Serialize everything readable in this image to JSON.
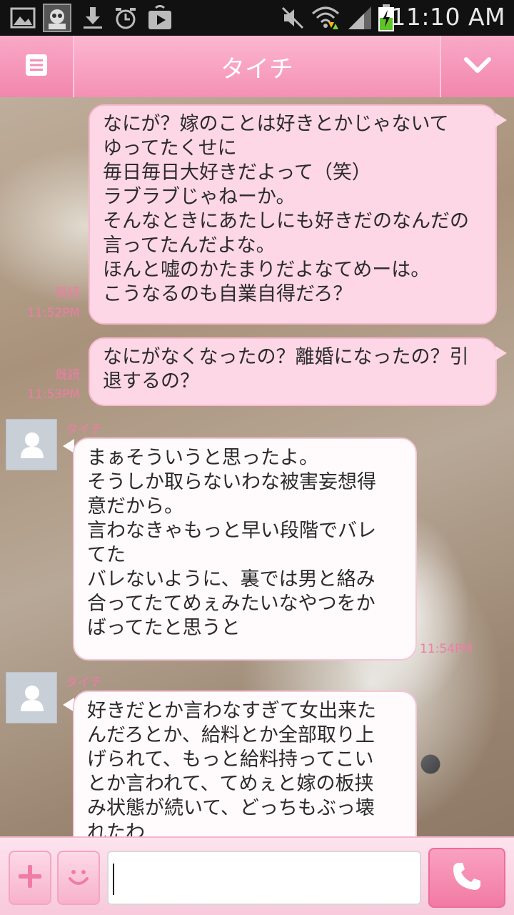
{
  "status_bar": {
    "time": "11:10 AM",
    "icons": [
      "gallery-icon",
      "app-avatar-icon",
      "download-icon",
      "alarm-icon",
      "play-store-icon",
      "mute-icon",
      "wifi-icon",
      "signal-icon",
      "battery-charging-icon"
    ]
  },
  "header": {
    "title": "タイチ",
    "menu_icon": "menu-list-icon",
    "dropdown_icon": "chevron-down-icon"
  },
  "messages": [
    {
      "side": "sent",
      "text": "なにが？嫁のことは好きとかじゃないて\nゆってたくせに\n毎日毎日大好きだよって（笑）\nラブラブじゃねーか。\nそんなときにあたしにも好きだのなんだの\n言ってたんだよな。\nほんと嘘のかたまりだよなてめーは。\nこうなるのも自業自得だろ？",
      "read": "既読",
      "time": "11:52PM"
    },
    {
      "side": "sent",
      "text": "なにがなくなったの？離婚になったの？引\n退するの？",
      "read": "既読",
      "time": "11:53PM"
    },
    {
      "side": "recv",
      "sender": "タイチ",
      "text": "まぁそういうと思ったよ。\nそうしか取らないわな被害妄想得\n意だから。\n言わなきゃもっと早い段階でバレ\nてた\nバレないように、裏では男と絡み\n合ってたてめぇみたいなやつをか\nばってたと思うと",
      "time": "11:54PM"
    },
    {
      "side": "recv",
      "sender": "タイチ",
      "text": "好きだとか言わなすぎて女出来た\nんだろとか、給料とか全部取り上\nげられて、もっと給料持ってこい\nとか言われて、てめぇと嫁の板挟\nみ状態が続いて、どっちもぶっ壊\nれたわ"
    }
  ],
  "bottom_bar": {
    "plus_icon": "plus-icon",
    "emoji_icon": "smiley-icon",
    "input_value": "",
    "call_icon": "phone-icon"
  },
  "colors": {
    "accent": "#f590b4",
    "sent_bubble": "#fdd7e6",
    "meta_text": "#f07ca6"
  }
}
